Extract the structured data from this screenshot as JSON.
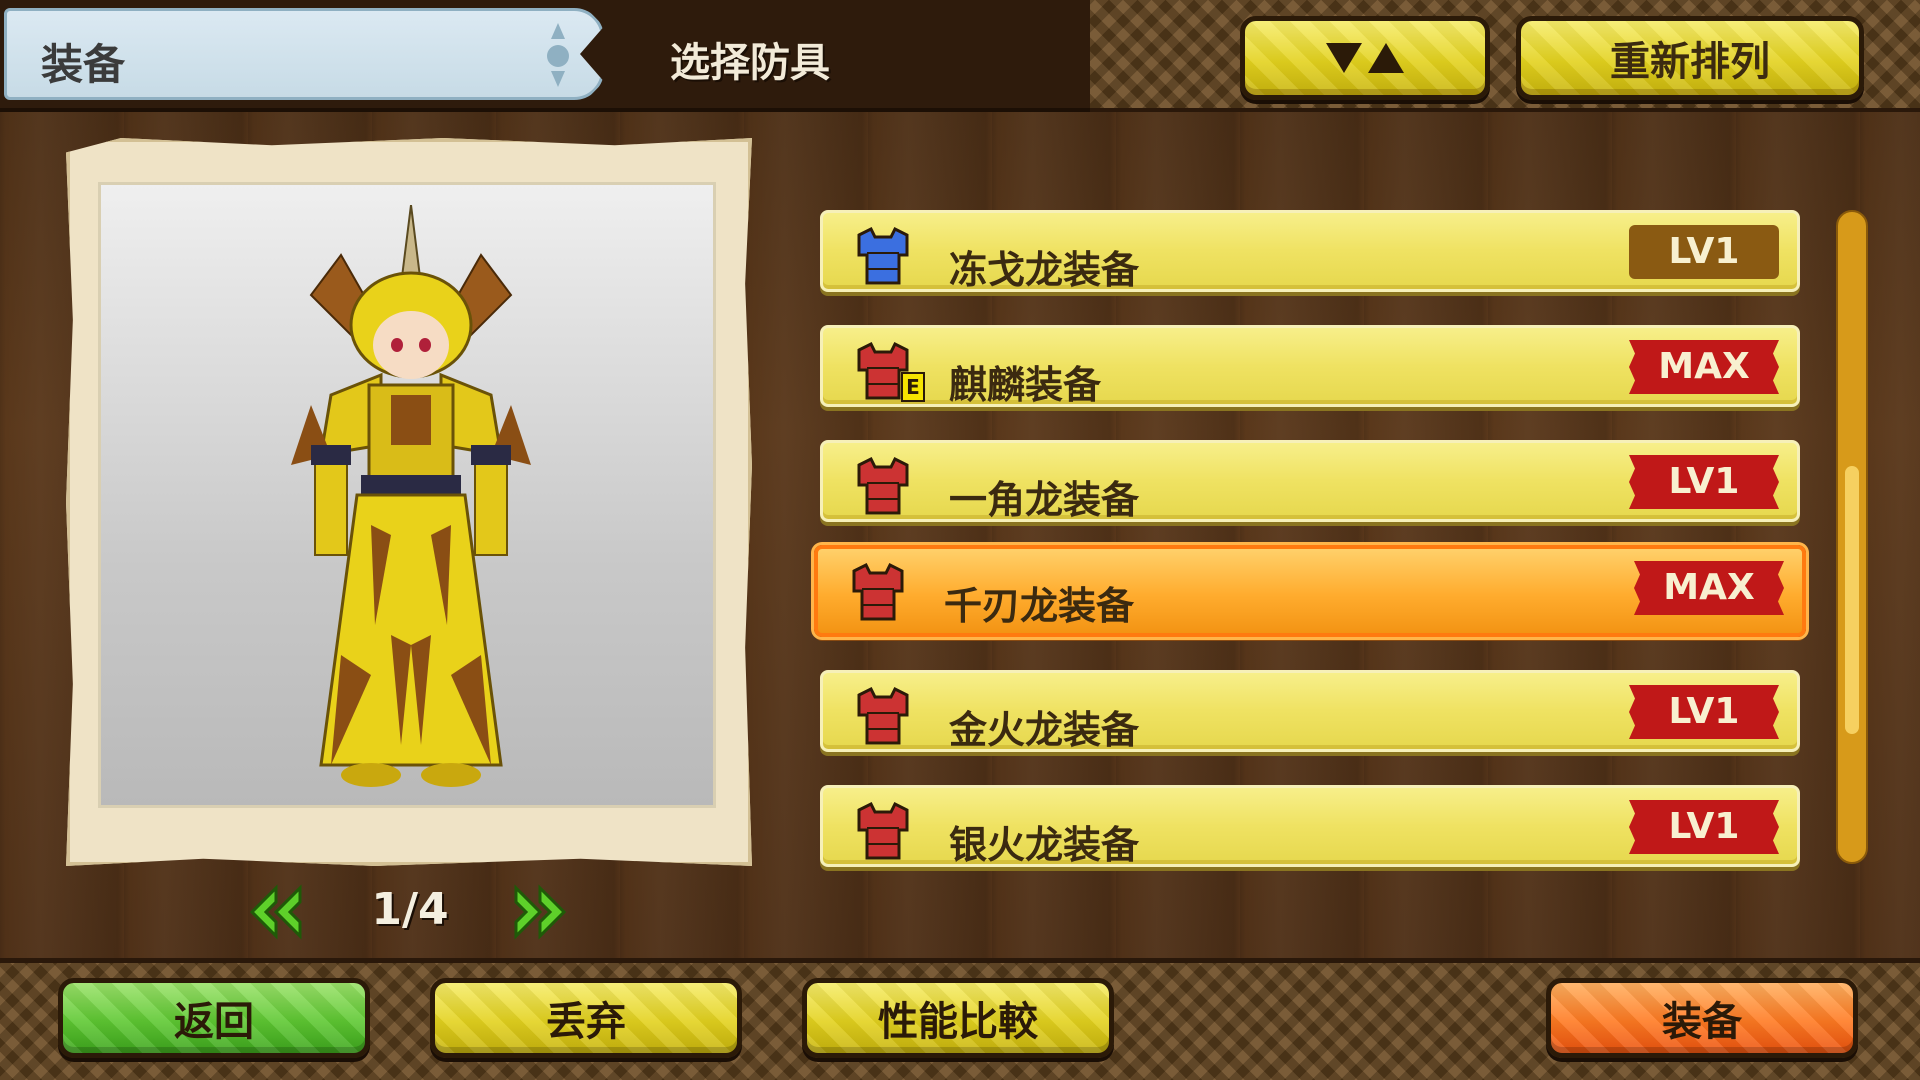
{
  "header": {
    "title": "装备",
    "subtitle": "选择防具",
    "sort_icon": "sort-toggle-icon",
    "resort_label": "重新排列"
  },
  "preview": {
    "page_indicator": "1/4",
    "prev_icon": "double-chevron-left-icon",
    "next_icon": "double-chevron-right-icon"
  },
  "armor_list": [
    {
      "name": "冻戈龙装备",
      "level": "LV1",
      "level_style": "brown",
      "icon_color": "#3b6fe0",
      "has_e_badge": false,
      "selected": false
    },
    {
      "name": "麒麟装备",
      "level": "MAX",
      "level_style": "red",
      "icon_color": "#c33",
      "has_e_badge": true,
      "e_badge": "E",
      "selected": false
    },
    {
      "name": "一角龙装备",
      "level": "LV1",
      "level_style": "red",
      "icon_color": "#c33",
      "has_e_badge": false,
      "selected": false
    },
    {
      "name": "千刃龙装备",
      "level": "MAX",
      "level_style": "red",
      "icon_color": "#c33",
      "has_e_badge": false,
      "selected": true
    },
    {
      "name": "金火龙装备",
      "level": "LV1",
      "level_style": "red",
      "icon_color": "#c33",
      "has_e_badge": false,
      "selected": false
    },
    {
      "name": "银火龙装备",
      "level": "LV1",
      "level_style": "red",
      "icon_color": "#c33",
      "has_e_badge": false,
      "selected": false
    }
  ],
  "footer": {
    "back_label": "返回",
    "discard_label": "丢弃",
    "compare_label": "性能比較",
    "equip_label": "装备"
  },
  "colors": {
    "accent_yellow": "#e3d21e",
    "selected_orange": "#ffac2e",
    "badge_red": "#c01818",
    "badge_brown": "#8a5a12",
    "back_green": "#5ec832"
  }
}
